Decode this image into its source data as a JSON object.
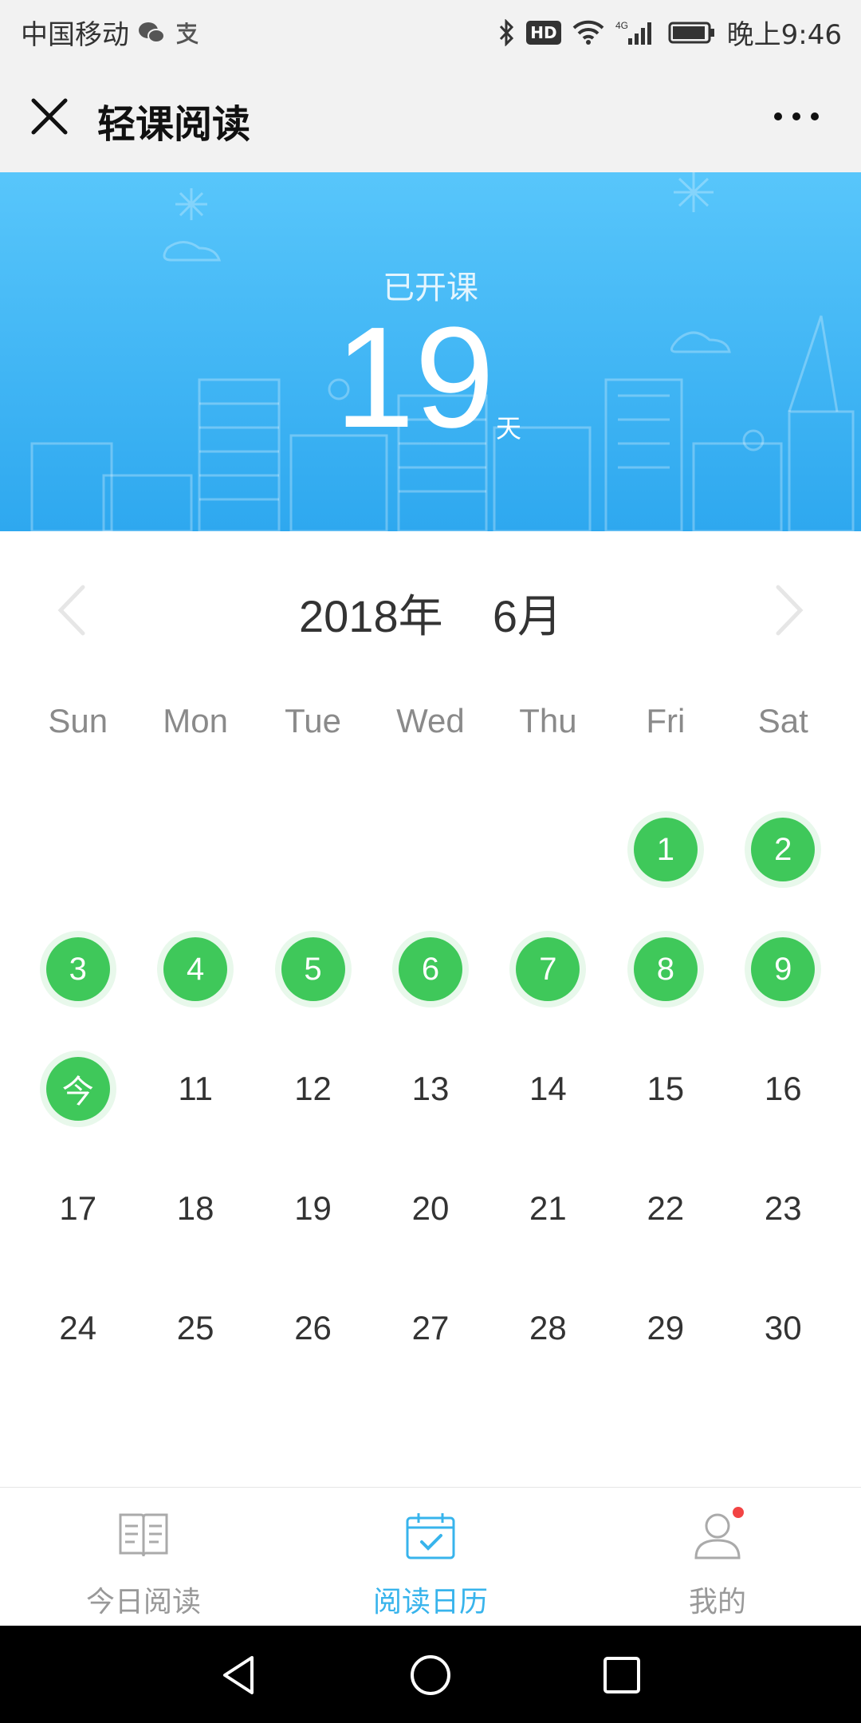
{
  "status_bar": {
    "carrier": "中国移动",
    "time": "晚上9:46",
    "hd": "HD",
    "network": "4G"
  },
  "title_bar": {
    "title": "轻课阅读"
  },
  "banner": {
    "label": "已开课",
    "days": "19",
    "unit": "天"
  },
  "calendar": {
    "month_label": "2018年    6月",
    "weekdays": [
      "Sun",
      "Mon",
      "Tue",
      "Wed",
      "Thu",
      "Fri",
      "Sat"
    ],
    "weeks": [
      [
        "",
        "",
        "",
        "",
        "",
        "1",
        "2"
      ],
      [
        "3",
        "4",
        "5",
        "6",
        "7",
        "8",
        "9"
      ],
      [
        "今",
        "11",
        "12",
        "13",
        "14",
        "15",
        "16"
      ],
      [
        "17",
        "18",
        "19",
        "20",
        "21",
        "22",
        "23"
      ],
      [
        "24",
        "25",
        "26",
        "27",
        "28",
        "29",
        "30"
      ]
    ],
    "checked_days": [
      "1",
      "2",
      "3",
      "4",
      "5",
      "6",
      "7",
      "8",
      "9",
      "今"
    ],
    "check_color": "#3fc85a"
  },
  "tab_bar": {
    "tabs": [
      {
        "label": "今日阅读",
        "icon": "open-book-icon",
        "active": false
      },
      {
        "label": "阅读日历",
        "icon": "calendar-check-icon",
        "active": true
      },
      {
        "label": "我的",
        "icon": "user-icon",
        "active": false,
        "badge": true
      }
    ],
    "active_color": "#38b4ec"
  }
}
